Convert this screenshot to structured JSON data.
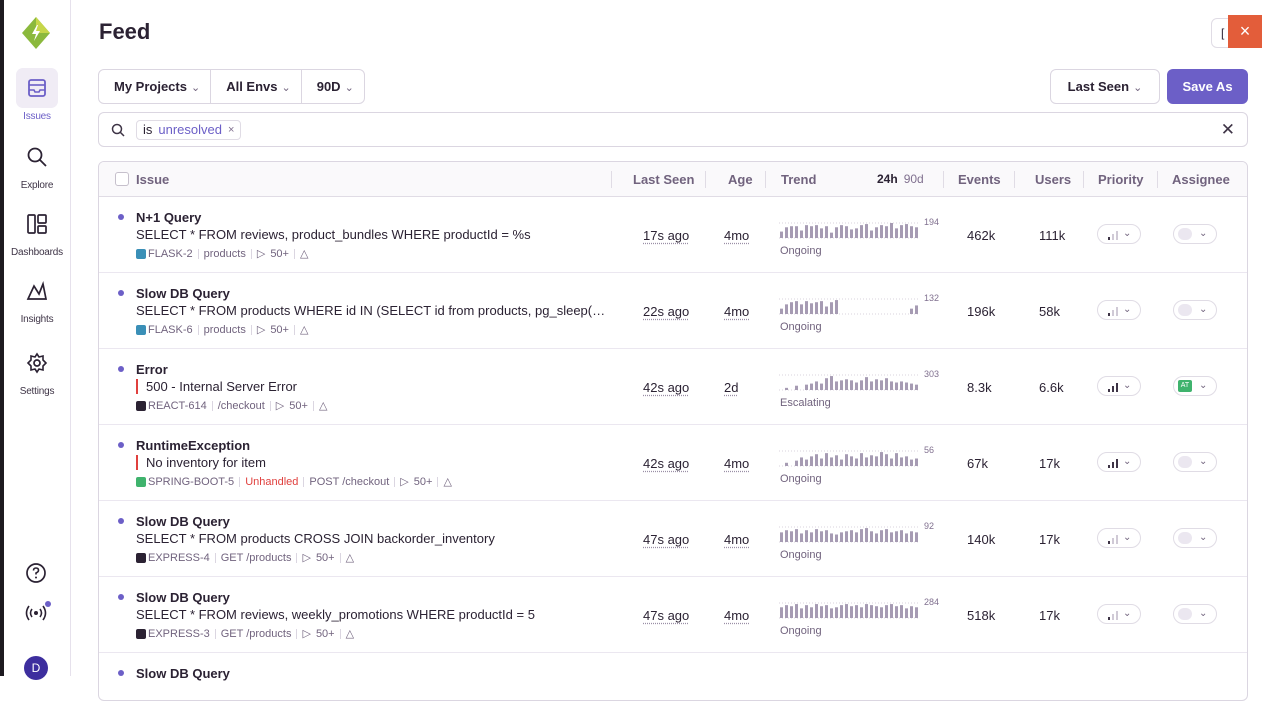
{
  "sidebar": {
    "items": [
      {
        "label": "Issues",
        "icon": "issues-icon",
        "active": true
      },
      {
        "label": "Explore",
        "icon": "search-icon",
        "active": false
      },
      {
        "label": "Dashboards",
        "icon": "dashboards-icon",
        "active": false
      },
      {
        "label": "Insights",
        "icon": "insights-icon",
        "active": false
      },
      {
        "label": "Settings",
        "icon": "gear-icon",
        "active": false
      }
    ],
    "avatar_initial": "D",
    "accent": "#6c5fc7"
  },
  "header": {
    "title": "Feed",
    "partial_button": "[",
    "close_label": "×"
  },
  "filters": {
    "project": "My Projects",
    "env": "All Envs",
    "period": "90D",
    "sort": "Last Seen",
    "save_label": "Save As"
  },
  "search": {
    "token_key": "is",
    "token_value": "unresolved",
    "token_remove": "×",
    "clear": "✕"
  },
  "table": {
    "headers": {
      "issue": "Issue",
      "last_seen": "Last Seen",
      "age": "Age",
      "trend": "Trend",
      "period_24h": "24h",
      "period_90d": "90d",
      "events": "Events",
      "users": "Users",
      "priority": "Priority",
      "assignee": "Assignee"
    },
    "rows": [
      {
        "title": "N+1 Query",
        "message": "SELECT * FROM reviews, product_bundles WHERE productId = %s",
        "error_style": false,
        "platform_color": "#3a8fb7",
        "short_id": "FLASK-2",
        "culprit": "products",
        "unhandled": "",
        "count_label": "50+",
        "last_seen": "17s ago",
        "age": "4mo",
        "trend_max": "194",
        "trend_status": "Ongoing",
        "trend_values": [
          6,
          10,
          11,
          11,
          7,
          12,
          11,
          12,
          9,
          11,
          5,
          10,
          12,
          11,
          8,
          9,
          12,
          13,
          7,
          10,
          12,
          11,
          14,
          9,
          12,
          13,
          11,
          10
        ],
        "events": "462k",
        "users": "111k",
        "priority_level": 1,
        "assignee": ""
      },
      {
        "title": "Slow DB Query",
        "message": "SELECT * FROM products WHERE id IN (SELECT id from products, pg_sleep(…",
        "error_style": false,
        "platform_color": "#3a8fb7",
        "short_id": "FLASK-6",
        "culprit": "products",
        "unhandled": "",
        "count_label": "50+",
        "last_seen": "22s ago",
        "age": "4mo",
        "trend_max": "132",
        "trend_status": "Ongoing",
        "trend_values": [
          5,
          9,
          11,
          12,
          9,
          12,
          10,
          11,
          12,
          7,
          11,
          13,
          0,
          0,
          0,
          0,
          0,
          0,
          0,
          0,
          0,
          0,
          0,
          0,
          0,
          0,
          5,
          8
        ],
        "events": "196k",
        "users": "58k",
        "priority_level": 1,
        "assignee": ""
      },
      {
        "title": "Error",
        "message": "500 - Internal Server Error",
        "error_style": true,
        "platform_color": "#2b2233",
        "short_id": "REACT-614",
        "culprit": "/checkout",
        "unhandled": "",
        "count_label": "50+",
        "last_seen": "42s ago",
        "age": "2d",
        "trend_max": "303",
        "trend_status": "Escalating",
        "trend_values": [
          0,
          2,
          0,
          4,
          0,
          5,
          6,
          8,
          6,
          11,
          13,
          8,
          9,
          10,
          9,
          7,
          9,
          12,
          8,
          10,
          9,
          11,
          8,
          7,
          8,
          7,
          6,
          5
        ],
        "events": "8.3k",
        "users": "6.6k",
        "priority_level": 3,
        "assignee": "AT"
      },
      {
        "title": "RuntimeException",
        "message": "No inventory for item",
        "error_style": true,
        "platform_color": "#3fb36d",
        "short_id": "SPRING-BOOT-5",
        "culprit": "POST /checkout",
        "unhandled": "Unhandled",
        "count_label": "50+",
        "last_seen": "42s ago",
        "age": "4mo",
        "trend_max": "56",
        "trend_status": "Ongoing",
        "trend_values": [
          0,
          3,
          0,
          5,
          8,
          6,
          9,
          11,
          7,
          12,
          8,
          10,
          6,
          11,
          9,
          7,
          12,
          8,
          10,
          9,
          13,
          11,
          7,
          12,
          8,
          9,
          6,
          7
        ],
        "events": "67k",
        "users": "17k",
        "priority_level": 3,
        "assignee": ""
      },
      {
        "title": "Slow DB Query",
        "message": "SELECT * FROM products CROSS JOIN backorder_inventory",
        "error_style": false,
        "platform_color": "#2b2233",
        "short_id": "EXPRESS-4",
        "culprit": "GET /products",
        "unhandled": "",
        "count_label": "50+",
        "last_seen": "47s ago",
        "age": "4mo",
        "trend_max": "92",
        "trend_status": "Ongoing",
        "trend_values": [
          9,
          11,
          10,
          12,
          8,
          11,
          9,
          12,
          10,
          11,
          8,
          7,
          9,
          10,
          11,
          9,
          12,
          13,
          10,
          8,
          11,
          12,
          9,
          10,
          11,
          8,
          10,
          9
        ],
        "events": "140k",
        "users": "17k",
        "priority_level": 1,
        "assignee": ""
      },
      {
        "title": "Slow DB Query",
        "message": "SELECT * FROM reviews, weekly_promotions WHERE productId = 5",
        "error_style": false,
        "platform_color": "#2b2233",
        "short_id": "EXPRESS-3",
        "culprit": "GET /products",
        "unhandled": "",
        "count_label": "50+",
        "last_seen": "47s ago",
        "age": "4mo",
        "trend_max": "284",
        "trend_status": "Ongoing",
        "trend_values": [
          10,
          12,
          11,
          13,
          9,
          12,
          10,
          13,
          11,
          12,
          9,
          10,
          12,
          13,
          11,
          12,
          10,
          13,
          12,
          11,
          10,
          12,
          13,
          11,
          12,
          9,
          11,
          10
        ],
        "events": "518k",
        "users": "17k",
        "priority_level": 1,
        "assignee": ""
      },
      {
        "title": "Slow DB Query",
        "message": "",
        "error_style": false,
        "platform_color": "#2b2233",
        "short_id": "",
        "culprit": "",
        "unhandled": "",
        "count_label": "",
        "last_seen": "",
        "age": "",
        "trend_max": "",
        "trend_status": "",
        "trend_values": [],
        "events": "",
        "users": "",
        "priority_level": 0,
        "assignee": ""
      }
    ]
  }
}
